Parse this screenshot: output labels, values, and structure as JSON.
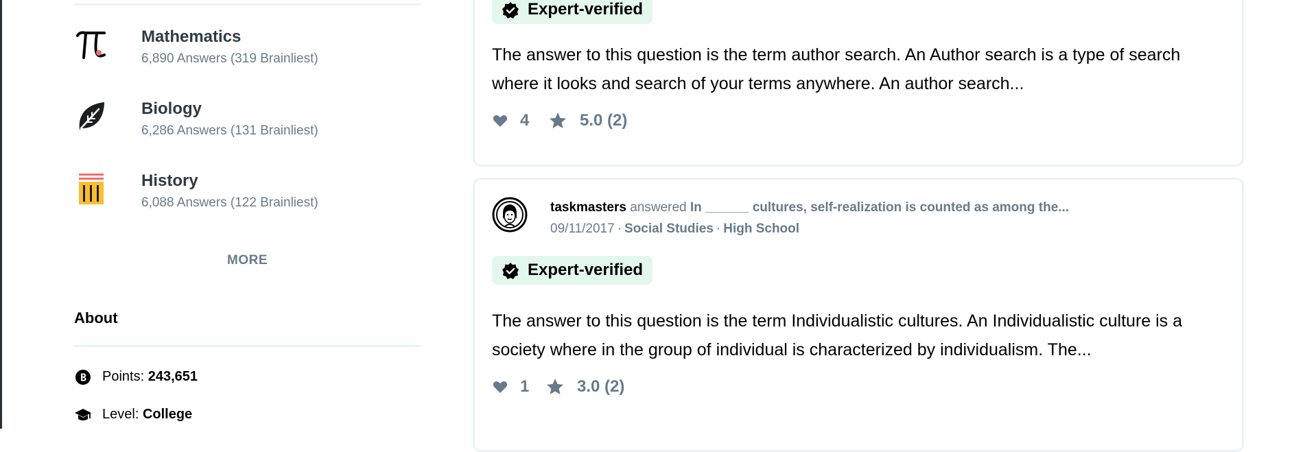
{
  "subjects": [
    {
      "name": "Mathematics",
      "answers": "6,890 Answers (319 Brainliest)",
      "icon": "pi-icon"
    },
    {
      "name": "Biology",
      "answers": "6,286 Answers (131 Brainliest)",
      "icon": "leaf-icon"
    },
    {
      "name": "History",
      "answers": "6,088 Answers (122 Brainliest)",
      "icon": "column-icon"
    }
  ],
  "more_label": "MORE",
  "about": {
    "title": "About",
    "points_label": "Points:",
    "points_value": "243,651",
    "level_label": "Level:",
    "level_value": "College"
  },
  "answers": [
    {
      "badge": "Expert-verified",
      "text": "The answer to this question is the term author search. An Author search is a type of search where it looks and search of your terms anywhere. An author search...",
      "likes": "4",
      "rating": "5.0 (2)"
    },
    {
      "user": "taskmasters",
      "action": "answered",
      "question": "In ______ cultures, self-realization is counted as among the...",
      "date": "09/11/2017",
      "subject": "Social Studies",
      "level": "High School",
      "badge": "Expert-verified",
      "text": "The answer to this question is the term Individualistic cultures. An Individualistic culture is a society where in the group of individual is characterized by individualism. The...",
      "likes": "1",
      "rating": "3.0 (2)"
    }
  ],
  "colors": {
    "gray_text": "#687b8c",
    "dark_text": "#2f3a44",
    "badge_bg": "#e3f7ec",
    "border": "#ebf2f7",
    "history_red": "#ef6f6f",
    "history_gold": "#fbbe2e"
  },
  "separator": "·"
}
